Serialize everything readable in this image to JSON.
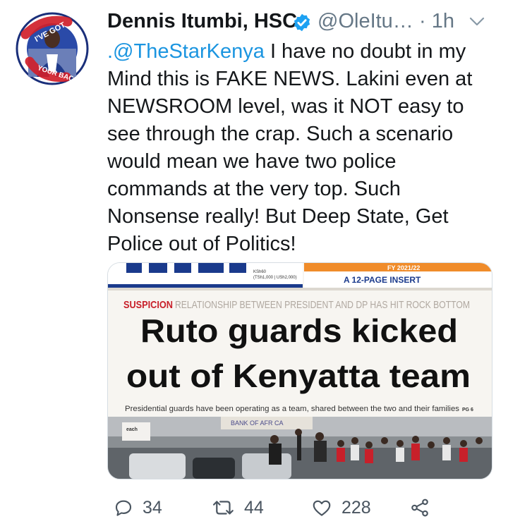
{
  "tweet": {
    "author_name": "Dennis Itumbi, HSC",
    "handle": "@OleItu…",
    "time": "· 1h",
    "mention": ".@TheStarKenya",
    "text": " I have no doubt in my Mind this is FAKE NEWS. Lakini even at NEWSROOM level, was it NOT easy to see through the crap. Such a scenario would mean we have two police commands at the very top. Such Nonsense really! But Deep State, Get Police out of Politics!",
    "avatar_badge_text": "I'VE GOT YOUR BACK"
  },
  "media": {
    "masthead_price": "KSh60",
    "masthead_price_sub": "(TSh1,000 | USh2,000)",
    "insert_year": "FY 2021/22",
    "insert_label": "A 12-PAGE INSERT",
    "kicker": "SUSPICION",
    "kicker_rest": "RELATIONSHIP BETWEEN PRESIDENT AND DP HAS HIT ROCK BOTTOM",
    "headline_line1": "Ruto guards kicked",
    "headline_line2": "out of Kenyatta team",
    "standfirst": "Presidential guards have been operating as a team, shared between the two and their families",
    "page_ref": "PG 6",
    "photo_sign": "BANK OF AFR CA",
    "photo_sign_small": "each"
  },
  "actions": {
    "replies": "34",
    "retweets": "44",
    "likes": "228"
  },
  "colors": {
    "link": "#1b95e0",
    "verified": "#1da1f2",
    "muted": "#657786",
    "kicker_red": "#c8202a",
    "insert_orange": "#f08c2a",
    "masthead_blue": "#1a3a8c"
  }
}
